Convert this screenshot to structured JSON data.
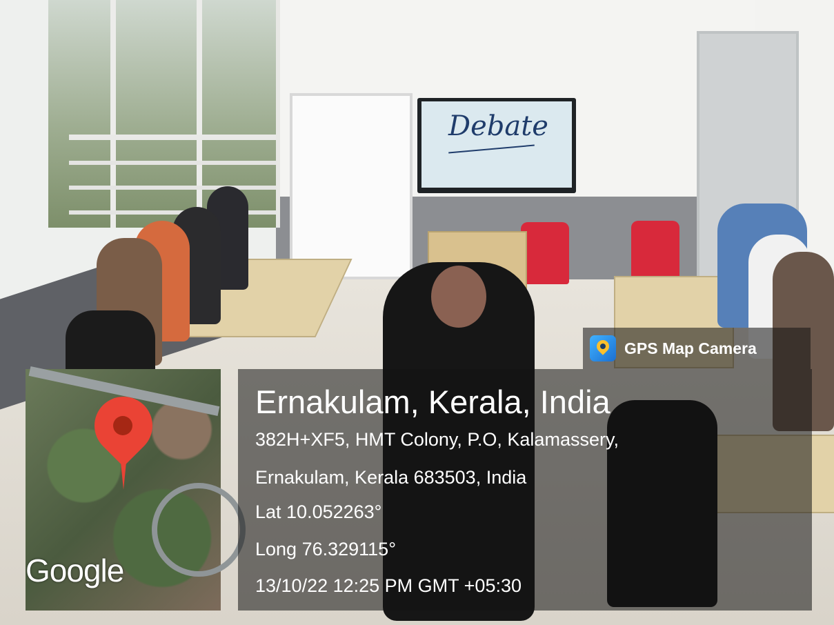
{
  "photo": {
    "screen_text": "Debate"
  },
  "overlay": {
    "app_label": "GPS Map Camera",
    "map_brand": "Google",
    "location_title": "Ernakulam, Kerala, India",
    "address_line1": "382H+XF5, HMT Colony, P.O, Kalamassery,",
    "address_line2": "Ernakulam, Kerala 683503, India",
    "latitude": "Lat 10.052263°",
    "longitude": "Long 76.329115°",
    "datetime": "13/10/22 12:25 PM GMT +05:30"
  },
  "colors": {
    "pin": "#ea4335",
    "overlay_bg": "rgba(20,20,20,0.55)",
    "text": "#ffffff"
  }
}
